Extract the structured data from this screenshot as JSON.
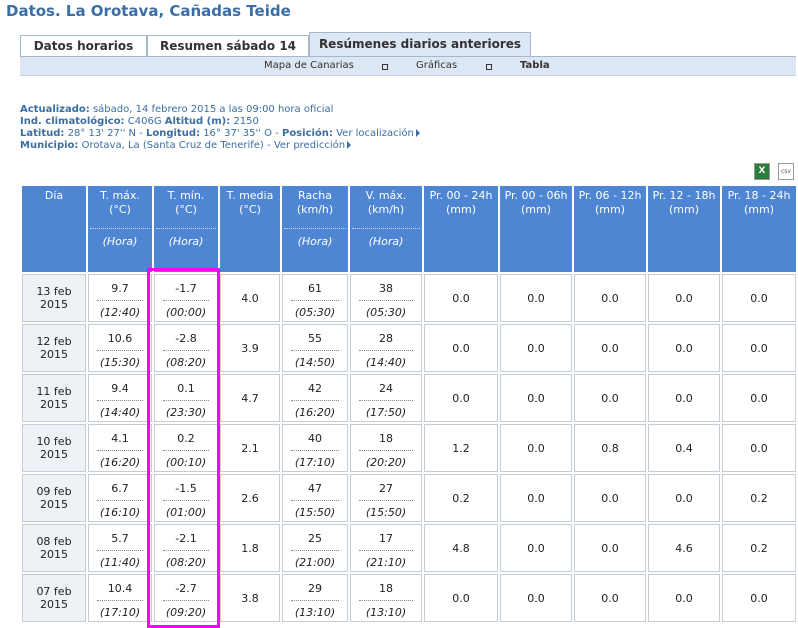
{
  "page": {
    "title": "Datos. La Orotava, Cañadas Teide"
  },
  "tabs": [
    {
      "label": "Datos horarios"
    },
    {
      "label": "Resumen sábado 14"
    },
    {
      "label": "Resúmenes diarios anteriores"
    }
  ],
  "subnav": {
    "map": "Mapa de Canarias",
    "graphs": "Gráficas",
    "table": "Tabla"
  },
  "info": {
    "updated_label": "Actualizado:",
    "updated_value": "sábado, 14 febrero 2015 a las 09:00 hora oficial",
    "ind_label": "Ind. climatológico:",
    "ind_value": "C406G",
    "alt_label": "Altitud (m):",
    "alt_value": "2150",
    "lat_label": "Latitud:",
    "lat_value": "28° 13' 27'' N",
    "lon_label": "Longitud:",
    "lon_value": "16° 37' 35'' O",
    "pos_label": "Posición:",
    "pos_link": "Ver localización",
    "mun_label": "Municipio:",
    "mun_value": "Orotava, La (Santa Cruz de Tenerife)",
    "pred_link": "Ver predicción"
  },
  "export": {
    "excel": "X",
    "csv": "csv"
  },
  "table": {
    "headers": {
      "day": "Día",
      "tmax": "T. máx. (°C)",
      "tmin": "T. mín. (°C)",
      "tmed": "T. media (°C)",
      "racha": "Racha (km/h)",
      "vmax": "V. máx. (km/h)",
      "p1": "Pr. 00 - 24h (mm)",
      "p2": "Pr. 00 - 06h (mm)",
      "p3": "Pr. 06 - 12h (mm)",
      "p4": "Pr. 12 - 18h (mm)",
      "p5": "Pr. 18 - 24h (mm)",
      "hora": "(Hora)"
    },
    "rows": [
      {
        "day": "13 feb 2015",
        "tmax": "9.7",
        "tmax_h": "(12:40)",
        "tmin": "-1.7",
        "tmin_h": "(00:00)",
        "tmed": "4.0",
        "racha": "61",
        "racha_h": "(05:30)",
        "vmax": "38",
        "vmax_h": "(05:30)",
        "p1": "0.0",
        "p2": "0.0",
        "p3": "0.0",
        "p4": "0.0",
        "p5": "0.0"
      },
      {
        "day": "12 feb 2015",
        "tmax": "10.6",
        "tmax_h": "(15:30)",
        "tmin": "-2.8",
        "tmin_h": "(08:20)",
        "tmed": "3.9",
        "racha": "55",
        "racha_h": "(14:50)",
        "vmax": "28",
        "vmax_h": "(14:40)",
        "p1": "0.0",
        "p2": "0.0",
        "p3": "0.0",
        "p4": "0.0",
        "p5": "0.0"
      },
      {
        "day": "11 feb 2015",
        "tmax": "9.4",
        "tmax_h": "(14:40)",
        "tmin": "0.1",
        "tmin_h": "(23:30)",
        "tmed": "4.7",
        "racha": "42",
        "racha_h": "(16:20)",
        "vmax": "24",
        "vmax_h": "(17:50)",
        "p1": "0.0",
        "p2": "0.0",
        "p3": "0.0",
        "p4": "0.0",
        "p5": "0.0"
      },
      {
        "day": "10 feb 2015",
        "tmax": "4.1",
        "tmax_h": "(16:20)",
        "tmin": "0.2",
        "tmin_h": "(00:10)",
        "tmed": "2.1",
        "racha": "40",
        "racha_h": "(17:10)",
        "vmax": "18",
        "vmax_h": "(20:20)",
        "p1": "1.2",
        "p2": "0.0",
        "p3": "0.8",
        "p4": "0.4",
        "p5": "0.0"
      },
      {
        "day": "09 feb 2015",
        "tmax": "6.7",
        "tmax_h": "(16:10)",
        "tmin": "-1.5",
        "tmin_h": "(01:00)",
        "tmed": "2.6",
        "racha": "47",
        "racha_h": "(15:50)",
        "vmax": "27",
        "vmax_h": "(15:50)",
        "p1": "0.2",
        "p2": "0.0",
        "p3": "0.0",
        "p4": "0.0",
        "p5": "0.2"
      },
      {
        "day": "08 feb 2015",
        "tmax": "5.7",
        "tmax_h": "(11:40)",
        "tmin": "-2.1",
        "tmin_h": "(08:20)",
        "tmed": "1.8",
        "racha": "25",
        "racha_h": "(21:00)",
        "vmax": "17",
        "vmax_h": "(21:10)",
        "p1": "4.8",
        "p2": "0.0",
        "p3": "0.0",
        "p4": "4.6",
        "p5": "0.2"
      },
      {
        "day": "07 feb 2015",
        "tmax": "10.4",
        "tmax_h": "(17:10)",
        "tmin": "-2.7",
        "tmin_h": "(09:20)",
        "tmed": "3.8",
        "racha": "29",
        "racha_h": "(13:10)",
        "vmax": "18",
        "vmax_h": "(13:10)",
        "p1": "0.0",
        "p2": "0.0",
        "p3": "0.0",
        "p4": "0.0",
        "p5": "0.0"
      }
    ]
  },
  "highlight_color": "#ff00ff"
}
